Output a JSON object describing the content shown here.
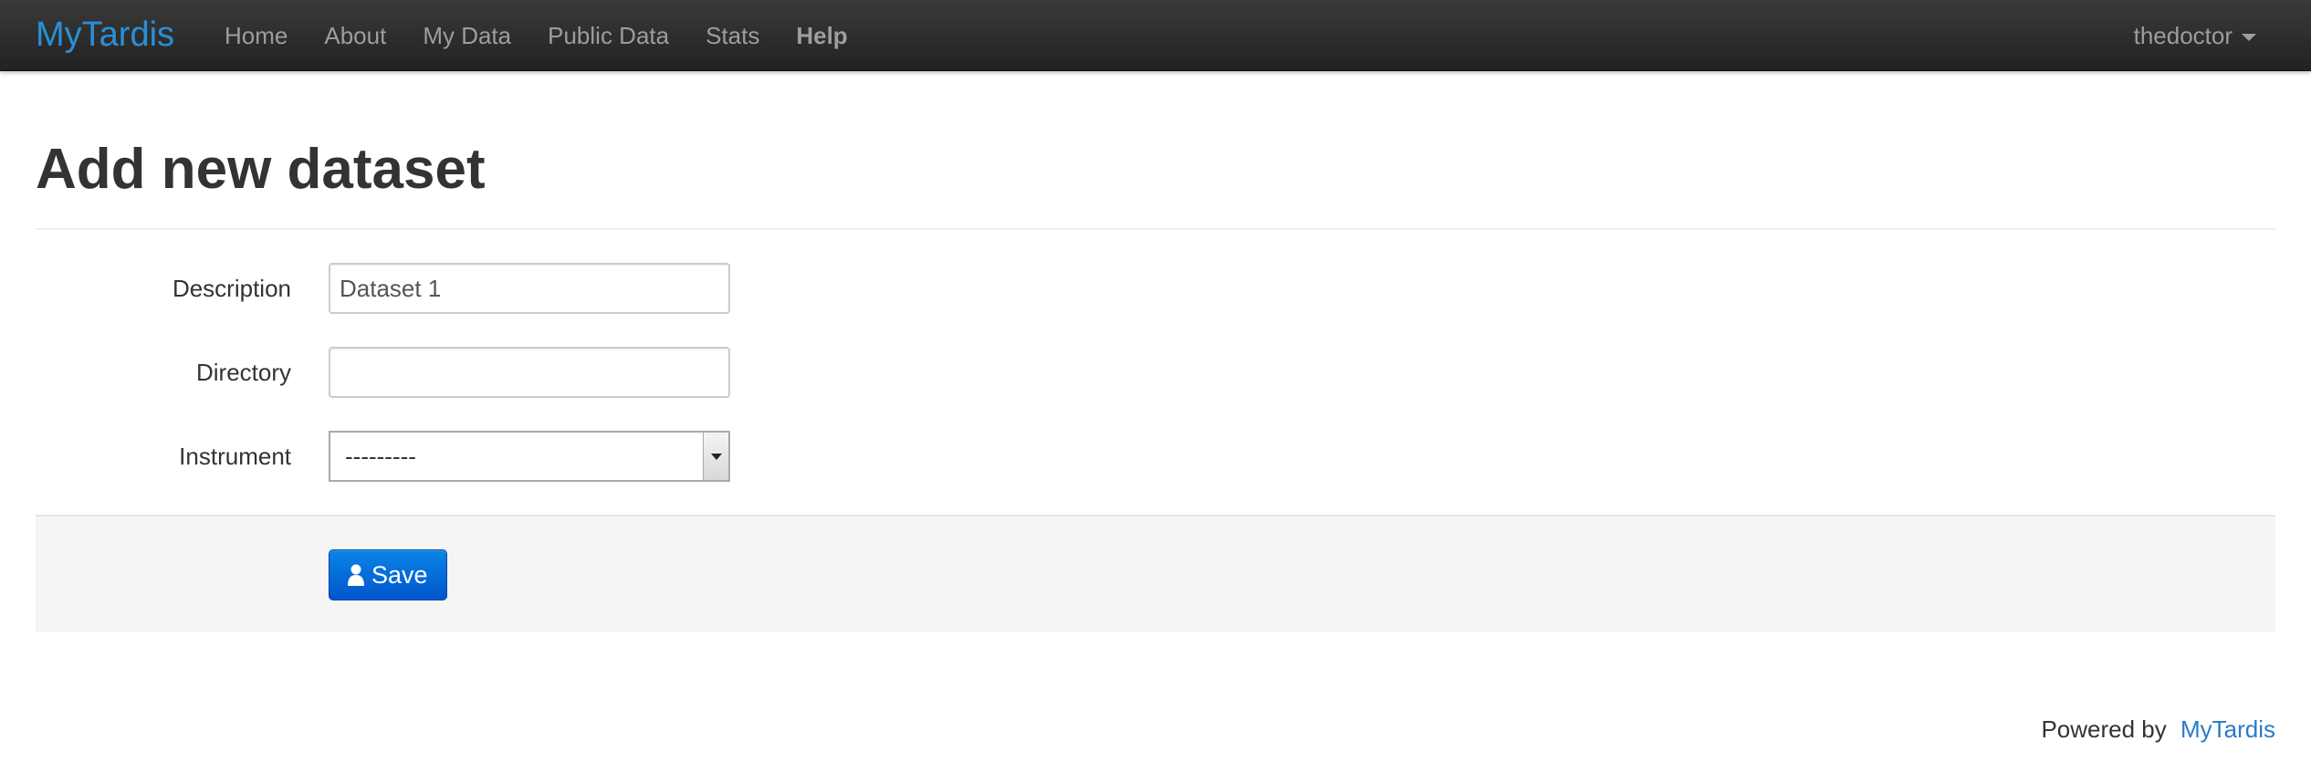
{
  "navbar": {
    "brand": "MyTardis",
    "items": [
      {
        "label": "Home"
      },
      {
        "label": "About"
      },
      {
        "label": "My Data"
      },
      {
        "label": "Public Data"
      },
      {
        "label": "Stats"
      },
      {
        "label": "Help"
      }
    ],
    "user": "thedoctor"
  },
  "page": {
    "title": "Add new dataset"
  },
  "form": {
    "description_label": "Description",
    "description_value": "Dataset 1",
    "directory_label": "Directory",
    "directory_value": "",
    "instrument_label": "Instrument",
    "instrument_selected": "---------",
    "save_label": "Save"
  },
  "footer": {
    "prefix": "Powered by",
    "link": "MyTardis"
  },
  "colors": {
    "brand": "#2a8fd6",
    "navbar_bg": "#222222",
    "primary_button": "#0066d6",
    "link": "#2a7bc8"
  }
}
